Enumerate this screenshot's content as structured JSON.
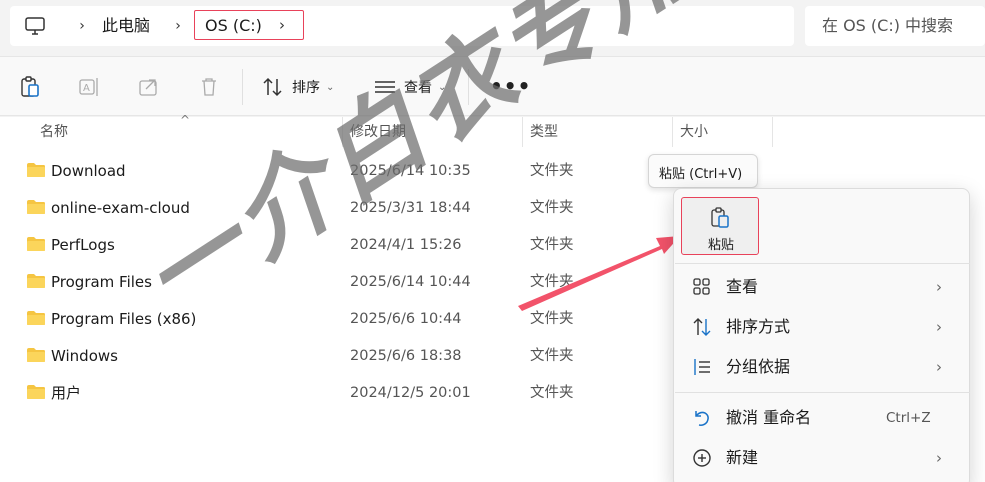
{
  "address_bar": {
    "crumbs": [
      "此电脑",
      "OS (C:)"
    ]
  },
  "search": {
    "placeholder": "在 OS (C:) 中搜索"
  },
  "toolbar": {
    "sort_label": "排序",
    "view_label": "查看",
    "more_label": "•••"
  },
  "columns": {
    "name": "名称",
    "modified": "修改日期",
    "type": "类型",
    "size": "大小"
  },
  "files": [
    {
      "name": "Download",
      "modified": "2025/6/14 10:35",
      "type": "文件夹"
    },
    {
      "name": "online-exam-cloud",
      "modified": "2025/3/31 18:44",
      "type": "文件夹"
    },
    {
      "name": "PerfLogs",
      "modified": "2024/4/1 15:26",
      "type": "文件夹"
    },
    {
      "name": "Program Files",
      "modified": "2025/6/14 10:44",
      "type": "文件夹"
    },
    {
      "name": "Program Files (x86)",
      "modified": "2025/6/6 10:44",
      "type": "文件夹"
    },
    {
      "name": "Windows",
      "modified": "2025/6/6 18:38",
      "type": "文件夹"
    },
    {
      "name": "用户",
      "modified": "2024/12/5 20:01",
      "type": "文件夹"
    }
  ],
  "tooltip": {
    "text": "粘贴 (Ctrl+V)"
  },
  "context_menu": {
    "paste_label": "粘贴",
    "items": [
      {
        "label": "查看",
        "icon": "grid-icon"
      },
      {
        "label": "排序方式",
        "icon": "sort-icon"
      },
      {
        "label": "分组依据",
        "icon": "group-icon"
      },
      {
        "label": "撤消 重命名",
        "icon": "undo-icon",
        "shortcut": "Ctrl+Z"
      },
      {
        "label": "新建",
        "icon": "plus-circle-icon"
      }
    ]
  },
  "watermark": {
    "text": "一介白衣专用"
  },
  "colors": {
    "highlight": "#e8425a",
    "folder": "#f5c542"
  }
}
